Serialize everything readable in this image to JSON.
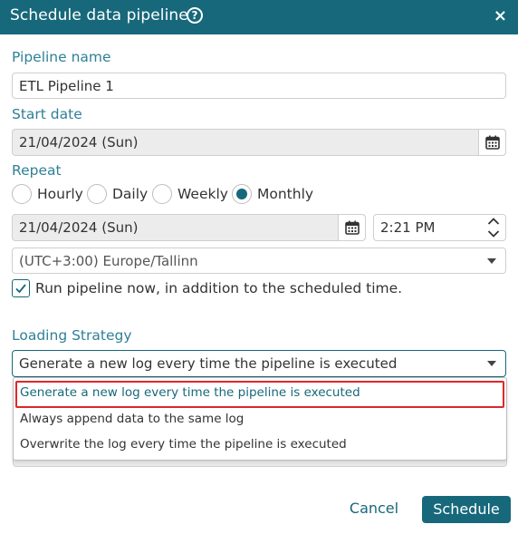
{
  "dialog": {
    "title": "Schedule data pipeline",
    "help_glyph": "?",
    "close_glyph": "×"
  },
  "pipeline_name": {
    "label": "Pipeline name",
    "value": "ETL Pipeline 1"
  },
  "start_date": {
    "label": "Start date",
    "value": "21/04/2024 (Sun)"
  },
  "repeat": {
    "label": "Repeat",
    "options": [
      "Hourly",
      "Daily",
      "Weekly",
      "Monthly"
    ],
    "selected": "Monthly",
    "date_value": "21/04/2024 (Sun)",
    "time_value": "2:21 PM",
    "timezone": "(UTC+3:00) Europe/Tallinn"
  },
  "run_now": {
    "label": "Run pipeline now, in addition to the scheduled time.",
    "checked": true
  },
  "loading_strategy": {
    "label": "Loading Strategy",
    "selected": "Generate a new log every time the pipeline is executed",
    "options": [
      "Generate a new log every time the pipeline is executed",
      "Always append data to the same log",
      "Overwrite the log every time the pipeline is executed"
    ]
  },
  "footer": {
    "cancel_label": "Cancel",
    "schedule_label": "Schedule"
  },
  "colors": {
    "accent": "#17687b",
    "label": "#2f8097",
    "highlight": "#e0262b"
  }
}
